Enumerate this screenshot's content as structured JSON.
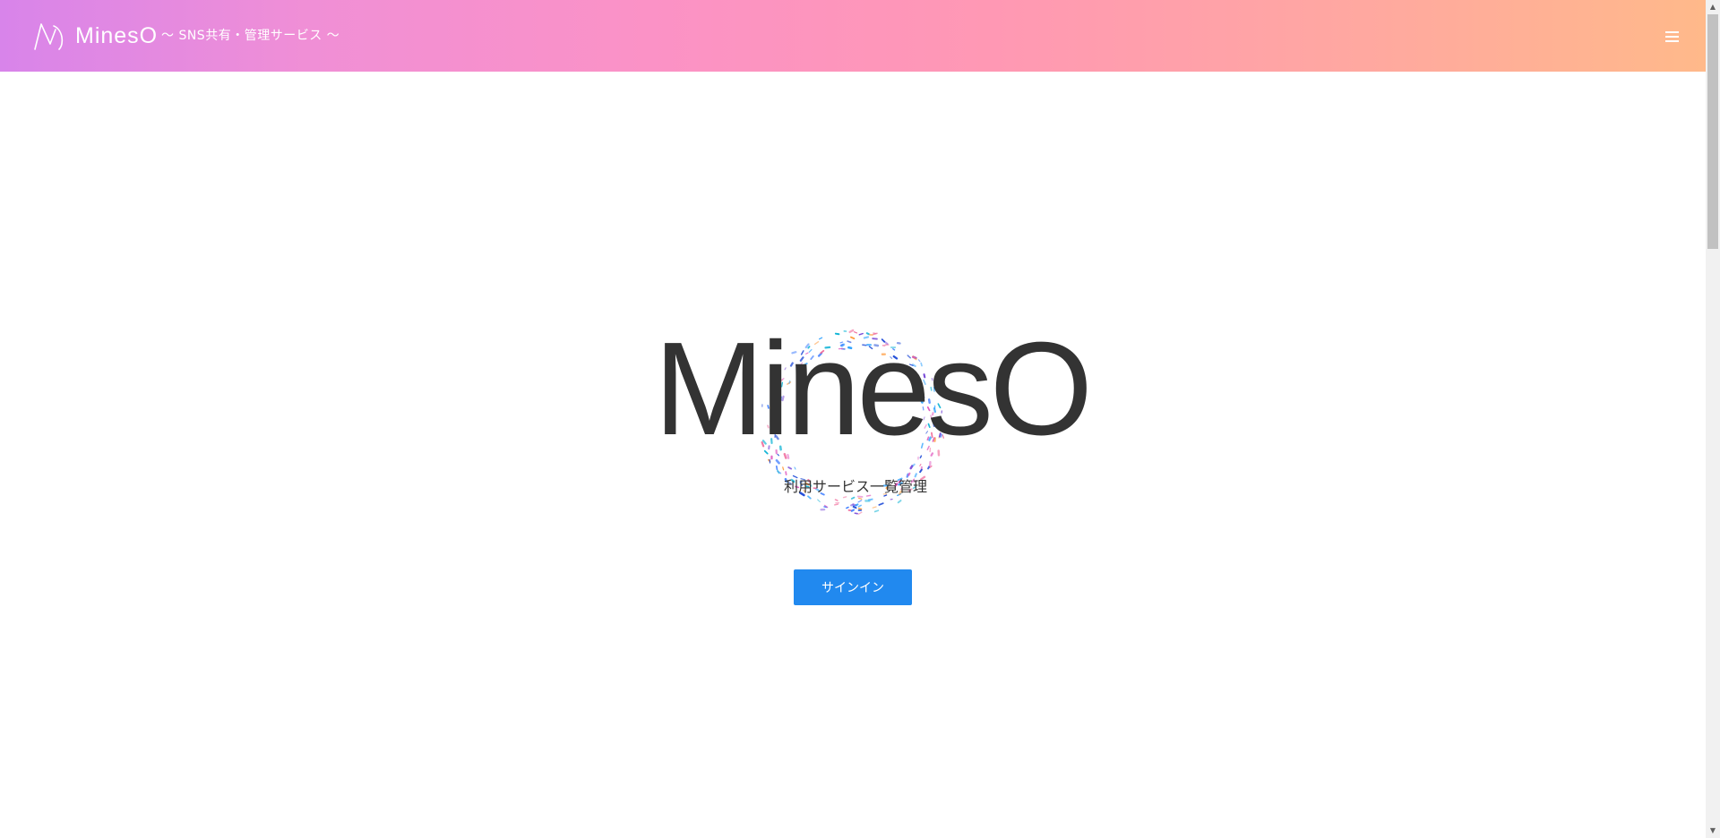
{
  "header": {
    "brand_name": "MinesO",
    "tagline": "～ SNS共有・管理サービス ～",
    "logo_icon": "mineso-logo-icon",
    "menu_icon": "hamburger-menu-icon",
    "gradient_colors": [
      "#d884ea",
      "#fb92c6",
      "#ffa8a0",
      "#ffb98a"
    ]
  },
  "hero": {
    "title": "MinesO",
    "subtitle": "利用サービス一覧管理",
    "decoration_icon": "particle-ring"
  },
  "actions": {
    "signin_label": "サインイン",
    "signin_color": "#2189ef"
  },
  "scrollbar": {
    "up_icon": "▲",
    "down_icon": "▼"
  }
}
